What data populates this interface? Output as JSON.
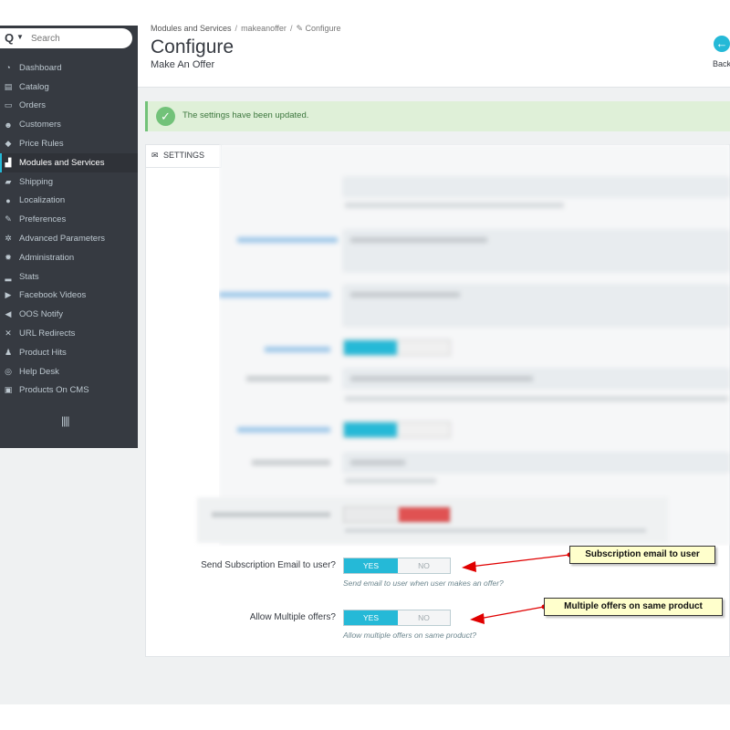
{
  "sidebar": {
    "search_placeholder": "Search",
    "items": [
      {
        "icon": "dashboard-icon",
        "glyph": "◔",
        "label": "Dashboard"
      },
      {
        "icon": "catalog-icon",
        "glyph": "▤",
        "label": "Catalog"
      },
      {
        "icon": "orders-icon",
        "glyph": "▭",
        "label": "Orders"
      },
      {
        "icon": "customers-icon",
        "glyph": "☻",
        "label": "Customers"
      },
      {
        "icon": "price-rules-icon",
        "glyph": "◆",
        "label": "Price Rules"
      },
      {
        "icon": "modules-icon",
        "glyph": "▟",
        "label": "Modules and Services",
        "active": true
      },
      {
        "icon": "shipping-icon",
        "glyph": "▰",
        "label": "Shipping"
      },
      {
        "icon": "localization-icon",
        "glyph": "●",
        "label": "Localization"
      },
      {
        "icon": "preferences-icon",
        "glyph": "✎",
        "label": "Preferences"
      },
      {
        "icon": "advanced-parameters-icon",
        "glyph": "✲",
        "label": "Advanced Parameters"
      },
      {
        "icon": "administration-icon",
        "glyph": "✹",
        "label": "Administration"
      },
      {
        "icon": "stats-icon",
        "glyph": "▂",
        "label": "Stats"
      },
      {
        "icon": "facebook-videos-icon",
        "glyph": "▶",
        "label": "Facebook Videos"
      },
      {
        "icon": "oos-notify-icon",
        "glyph": "◀",
        "label": "OOS Notify"
      },
      {
        "icon": "url-redirects-icon",
        "glyph": "✕",
        "label": "URL Redirects"
      },
      {
        "icon": "product-hits-icon",
        "glyph": "♟",
        "label": "Product Hits"
      },
      {
        "icon": "help-desk-icon",
        "glyph": "◎",
        "label": "Help Desk"
      },
      {
        "icon": "products-on-cms-icon",
        "glyph": "▣",
        "label": "Products On CMS"
      }
    ],
    "collapse_glyph": "||||"
  },
  "header": {
    "breadcrumb": [
      "Modules and Services",
      "makeanoffer",
      "Configure"
    ],
    "title": "Configure",
    "subtitle": "Make An Offer",
    "back_label": "Back"
  },
  "alert": {
    "text": "The settings have been updated."
  },
  "panel": {
    "tab_label": "SETTINGS"
  },
  "form": {
    "rows": [
      {
        "label": "Send Subscription Email to user?",
        "yes": "YES",
        "no": "NO",
        "value": "YES",
        "help": "Send email to user when user makes an offer?"
      },
      {
        "label": "Allow Multiple offers?",
        "yes": "YES",
        "no": "NO",
        "value": "YES",
        "help": "Allow multiple offers on same product?"
      }
    ]
  },
  "callouts": [
    {
      "text": "Subscription email to user"
    },
    {
      "text": "Multiple offers on same product"
    }
  ],
  "colors": {
    "sidebar_bg": "#363a41",
    "accent": "#25b9d7",
    "success_bg": "#dff0d8",
    "success_icon": "#72c279",
    "callout_bg": "#ffffcc",
    "arrow": "#e00000"
  }
}
